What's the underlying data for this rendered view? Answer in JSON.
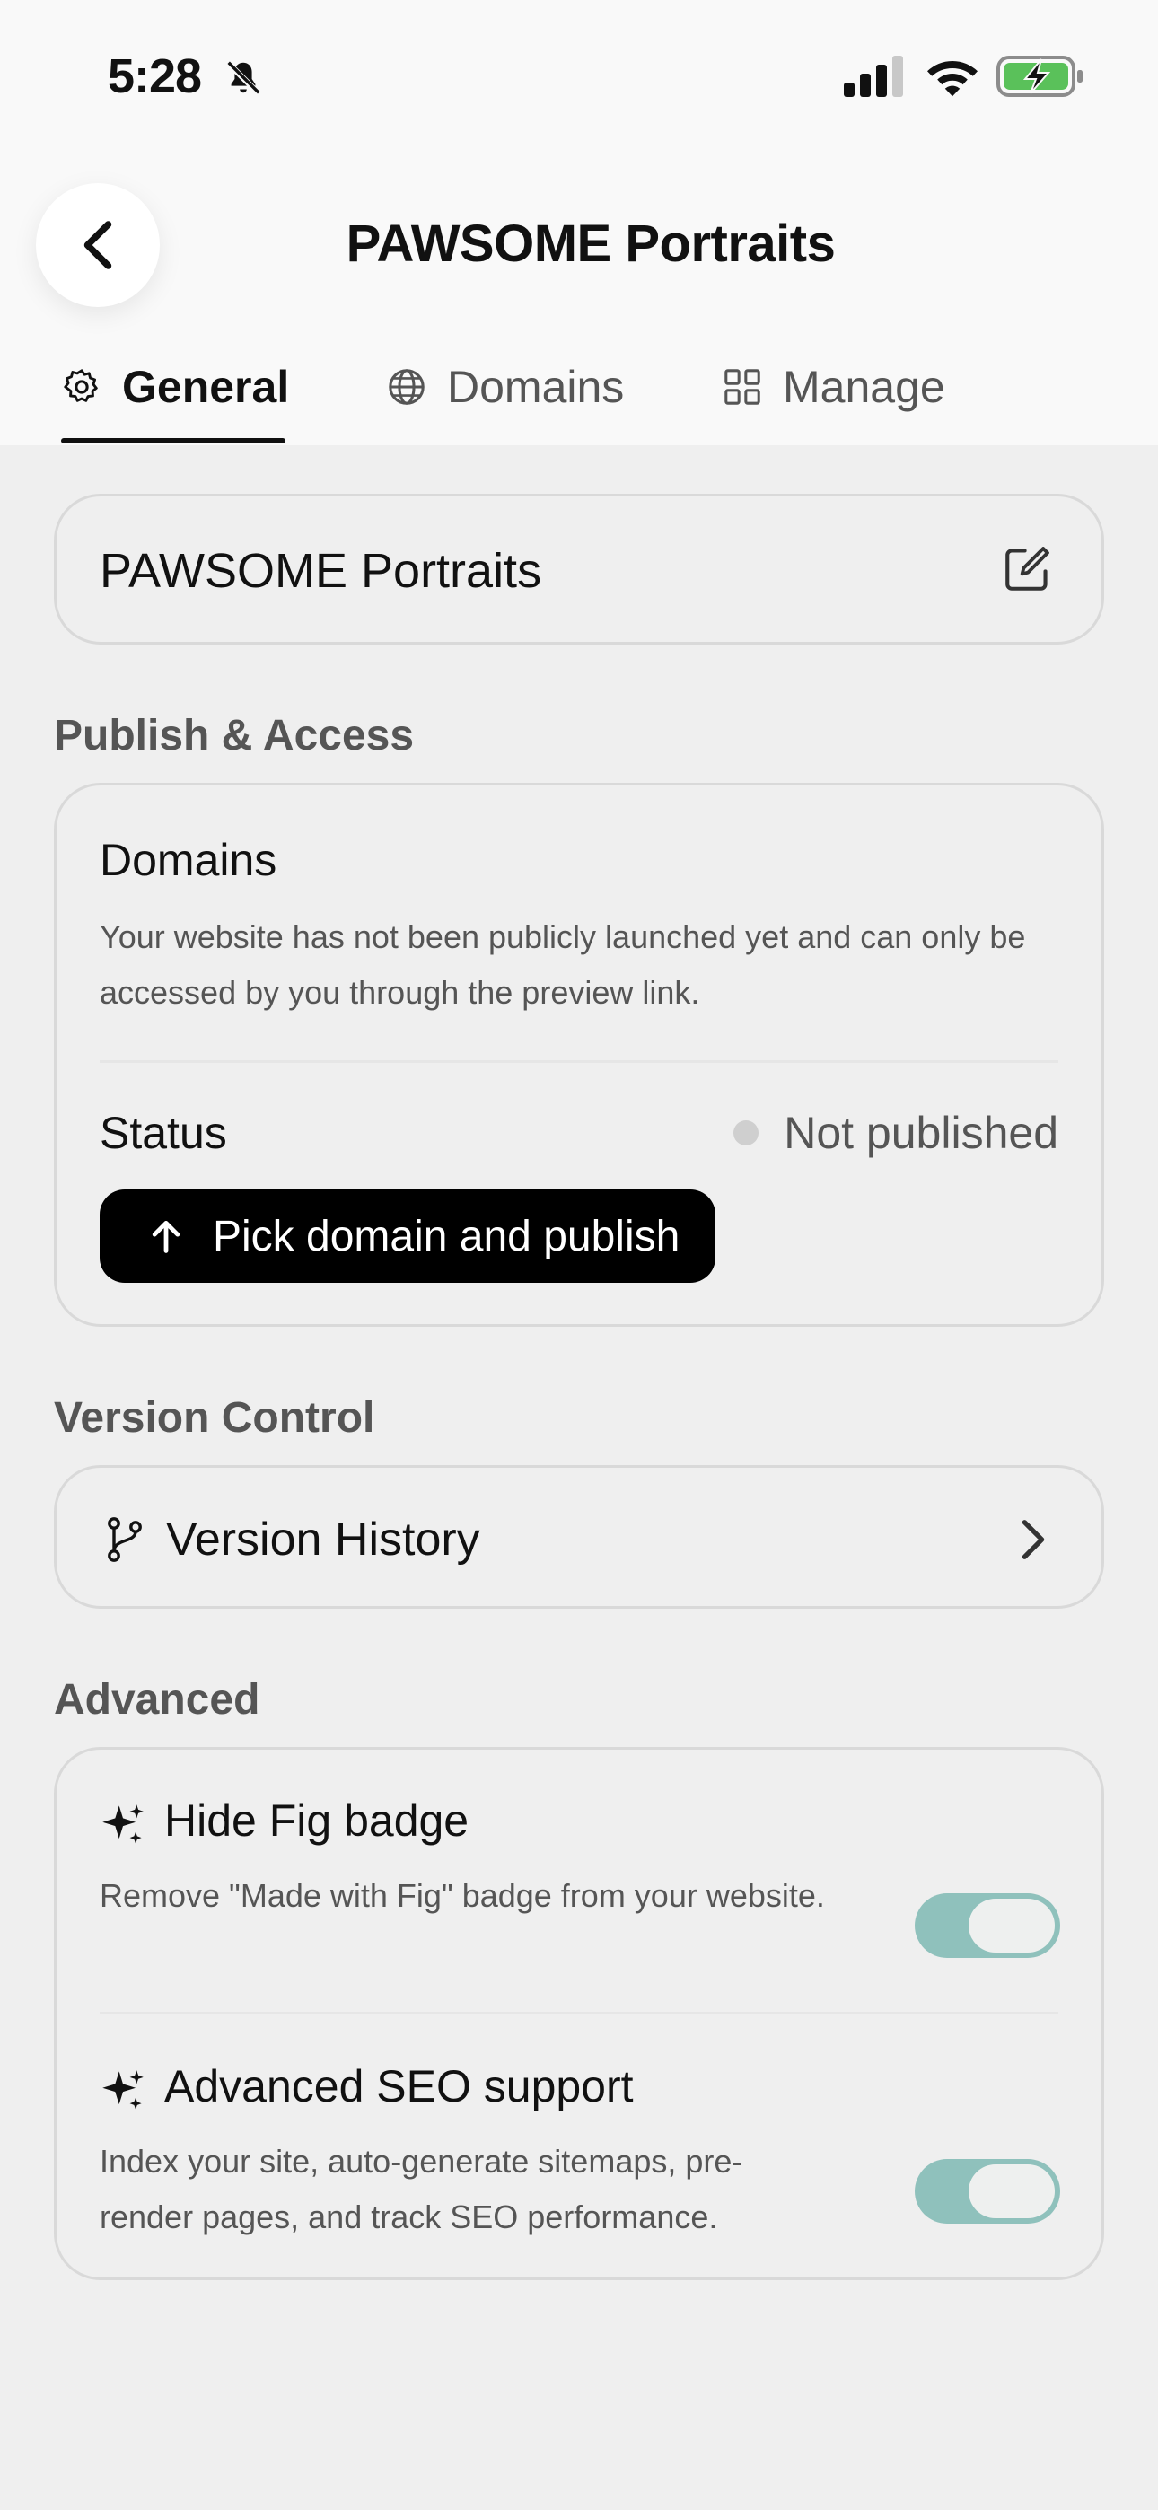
{
  "status_bar": {
    "time": "5:28"
  },
  "header": {
    "title": "PAWSOME Portraits",
    "back_icon": "chevron-left-icon"
  },
  "tabs": [
    {
      "label": "General",
      "icon": "gear-icon",
      "active": true
    },
    {
      "label": "Domains",
      "icon": "globe-icon",
      "active": false
    },
    {
      "label": "Manage",
      "icon": "grid-icon",
      "active": false
    }
  ],
  "site_name": {
    "value": "PAWSOME Portraits",
    "icon": "edit-icon"
  },
  "publish_access": {
    "section_title": "Publish & Access",
    "domains_title": "Domains",
    "domains_desc": "Your website has not been publicly launched yet and can only be accessed by you through the preview link.",
    "status_label": "Status",
    "status_value": "Not published",
    "publish_button": "Pick domain and publish"
  },
  "version_control": {
    "section_title": "Version Control",
    "item_label": "Version History"
  },
  "advanced": {
    "section_title": "Advanced",
    "items": [
      {
        "title": "Hide Fig badge",
        "desc": "Remove \"Made with Fig\" badge from your website.",
        "enabled": true
      },
      {
        "title": "Advanced SEO support",
        "desc": "Index your site, auto-generate sitemaps, pre-render pages, and track SEO performance.",
        "enabled": true
      }
    ]
  },
  "colors": {
    "toggle_on": "#8fc1bc",
    "button_bg": "#000000",
    "page_bg": "#efefef"
  }
}
